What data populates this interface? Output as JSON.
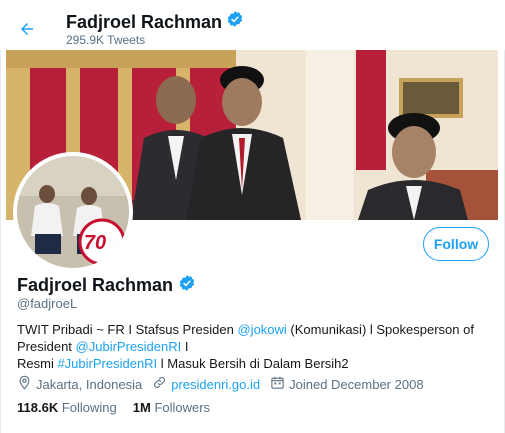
{
  "header": {
    "name": "Fadjroel Rachman",
    "tweet_count": "295.9K Tweets"
  },
  "profile": {
    "name": "Fadjroel Rachman",
    "handle": "@fadjroeL",
    "follow_label": "Follow",
    "avatar_badge": "70",
    "bio": {
      "line1_a": "TWIT Pribadi ~ FR I Stafsus Presiden ",
      "mention_jokowi": "@jokowi",
      "line1_b": " (Komunikasi) l Spokesperson of",
      "line2_a": "President ",
      "mention_jubir": "@JubirPresidenRI",
      "line2_b": " I",
      "line3_a": "Resmi ",
      "hashtag": "#JubirPresidenRI",
      "line3_b": " l Masuk Bersih di Dalam Bersih2"
    },
    "location": "Jakarta, Indonesia",
    "website": "presidenri.go.id",
    "joined": "Joined December 2008",
    "following_count": "118.6K",
    "following_label": "Following",
    "followers_count": "1M",
    "followers_label": "Followers"
  },
  "colors": {
    "accent": "#1da1f2",
    "secondary_text": "#5b7083",
    "verified": "#1da1f2"
  }
}
